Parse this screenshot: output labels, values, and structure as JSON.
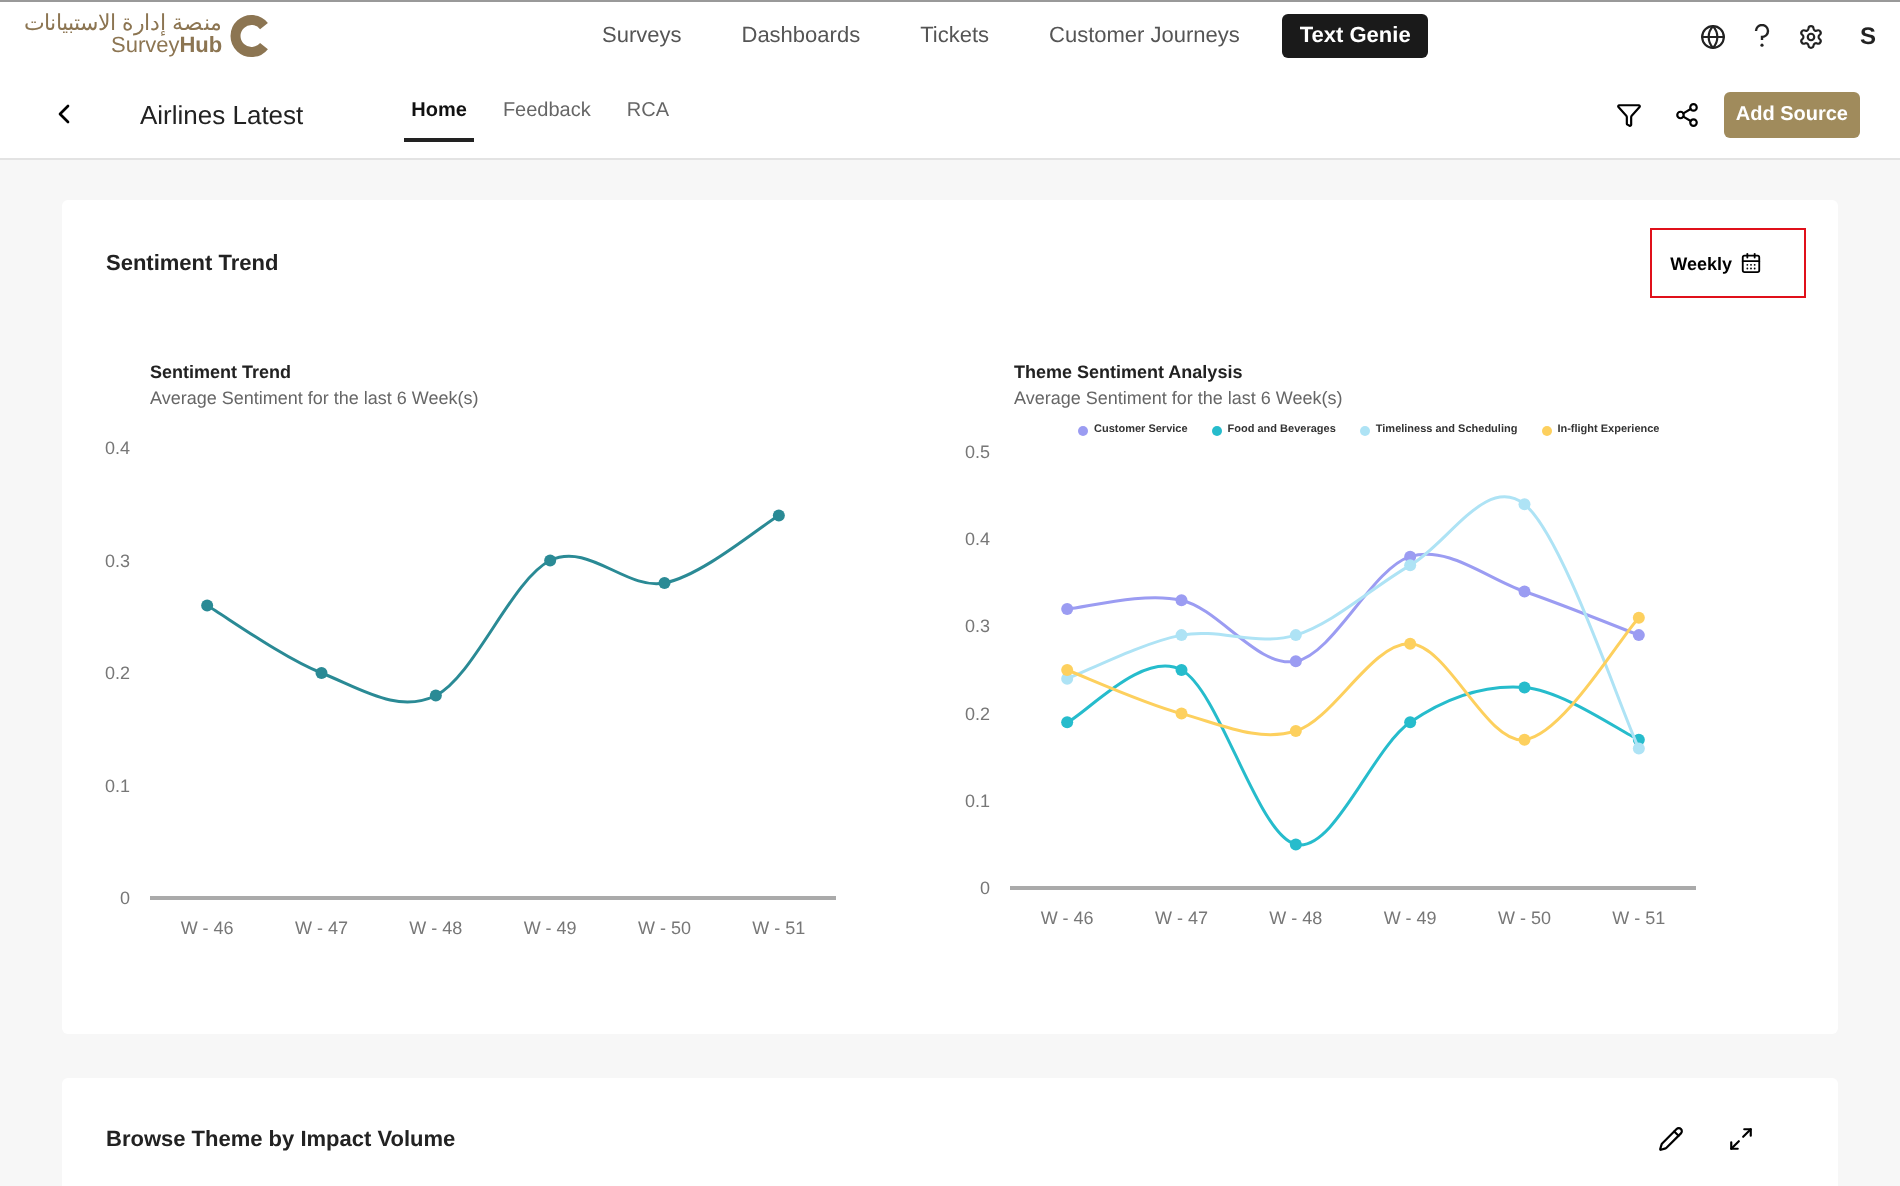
{
  "brand": {
    "arabic": "منصة إدارة الاستبيانات",
    "name_part1": "Survey",
    "name_part2": "Hub"
  },
  "nav": [
    {
      "label": "Surveys",
      "selected": false
    },
    {
      "label": "Dashboards",
      "selected": false
    },
    {
      "label": "Tickets",
      "selected": false
    },
    {
      "label": "Customer Journeys",
      "selected": false
    },
    {
      "label": "Text Genie",
      "selected": true
    }
  ],
  "user_initial": "S",
  "page_title": "Airlines Latest",
  "tabs": [
    {
      "label": "Home",
      "selected": true
    },
    {
      "label": "Feedback",
      "selected": false
    },
    {
      "label": "RCA",
      "selected": false
    }
  ],
  "add_source": "Add Source",
  "card": {
    "title": "Sentiment Trend",
    "period": "Weekly",
    "period_highlighted": true,
    "charts": [
      {
        "title": "Sentiment Trend",
        "subtitle": "Average Sentiment for the last 6 Week(s)",
        "chart_data": {
          "type": "line",
          "categories": [
            "W - 46",
            "W - 47",
            "W - 48",
            "W - 49",
            "W - 50",
            "W - 51"
          ],
          "ylim": [
            0,
            0.4
          ],
          "yticks": [
            0,
            0.1,
            0.2,
            0.3,
            0.4
          ],
          "series": [
            {
              "color": "#2a8a95",
              "marker": true,
              "values": [
                0.26,
                0.2,
                0.18,
                0.3,
                0.28,
                0.34
              ]
            }
          ]
        }
      },
      {
        "title": "Theme Sentiment Analysis",
        "subtitle": "Average Sentiment for the last 6 Week(s)",
        "chart_data": {
          "type": "line",
          "categories": [
            "W - 46",
            "W - 47",
            "W - 48",
            "W - 49",
            "W - 50",
            "W - 51"
          ],
          "ylim": [
            0,
            0.5
          ],
          "yticks": [
            0,
            0.1,
            0.2,
            0.3,
            0.4,
            0.5
          ],
          "series": [
            {
              "name": "Customer Service",
              "color": "#9b9cf2",
              "marker": true,
              "values": [
                0.32,
                0.33,
                0.26,
                0.38,
                0.34,
                0.29
              ]
            },
            {
              "name": "Food and Beverages",
              "color": "#26bccc",
              "marker": true,
              "values": [
                0.19,
                0.25,
                0.05,
                0.19,
                0.23,
                0.17
              ]
            },
            {
              "name": "Timeliness and Scheduling",
              "color": "#aee3f5",
              "marker": true,
              "values": [
                0.24,
                0.29,
                0.29,
                0.37,
                0.44,
                0.16
              ]
            },
            {
              "name": "In-flight Experience",
              "color": "#fdd05e",
              "marker": true,
              "values": [
                0.25,
                0.2,
                0.18,
                0.28,
                0.17,
                0.31
              ]
            }
          ]
        }
      }
    ]
  },
  "card2": {
    "title": "Browse Theme by Impact Volume"
  }
}
